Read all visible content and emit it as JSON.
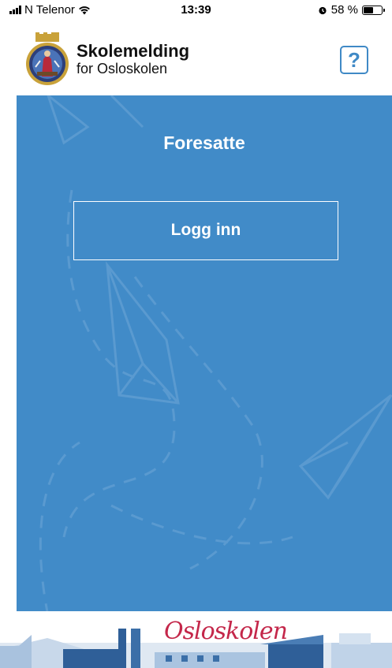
{
  "status_bar": {
    "carrier": "N Telenor",
    "time": "13:39",
    "battery_text": "58 %",
    "battery_level": 0.58
  },
  "header": {
    "title": "Skolemelding",
    "subtitle": "for Osloskolen",
    "help_label": "?"
  },
  "main": {
    "heading": "Foresatte",
    "login_label": "Logg inn"
  },
  "footer": {
    "brand": "Osloskolen"
  },
  "colors": {
    "panel_blue": "#418bc8",
    "accent_blue": "#3f89c6",
    "brand_red": "#c4274a"
  }
}
